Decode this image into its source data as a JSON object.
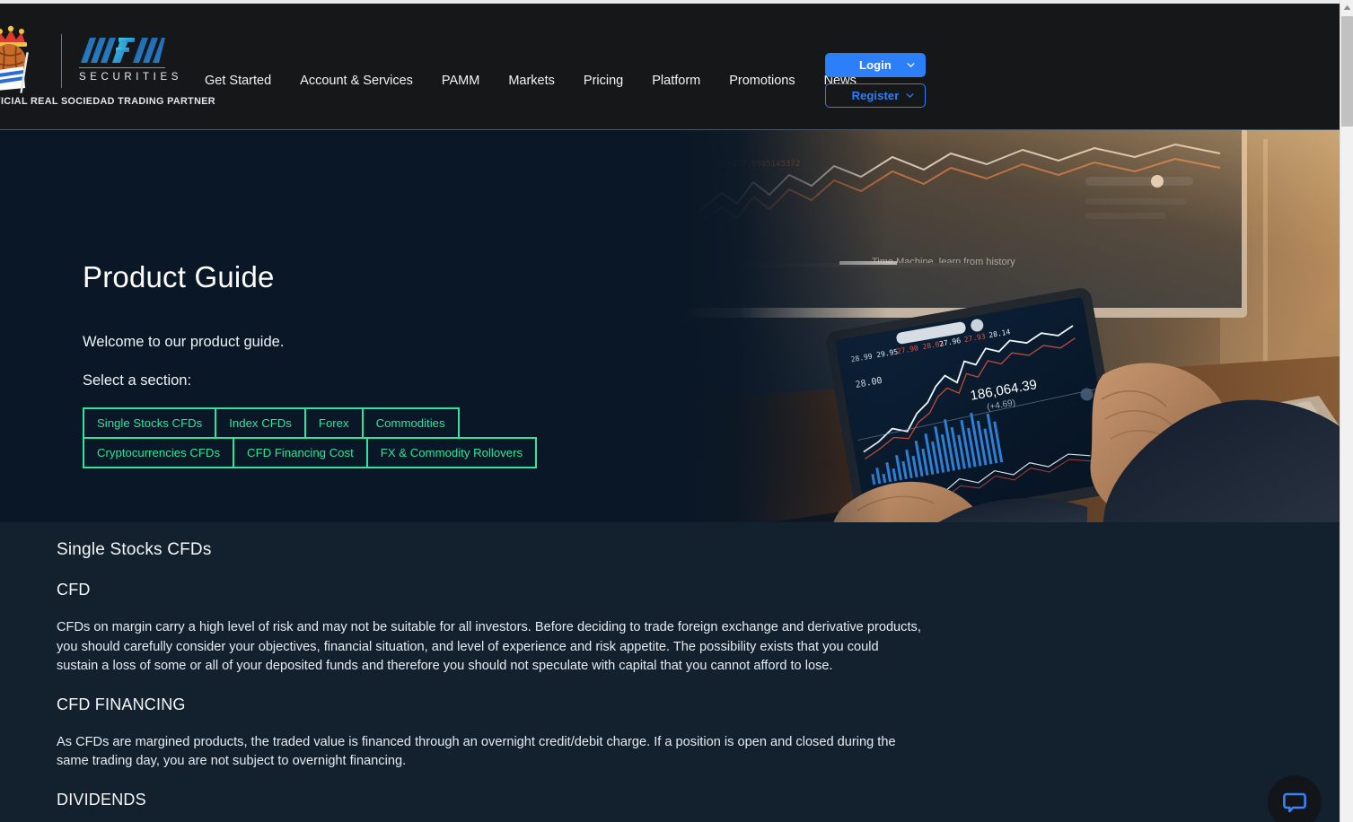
{
  "brand": {
    "crest_name": "real-sociedad-crest",
    "logo_word": "SECURITIES",
    "partner_tagline": "FICIAL REAL SOCIEDAD TRADING PARTNER",
    "accent_blue": "#2d7ff9",
    "accent_green": "#2ee59d",
    "nav_background": "#151719",
    "hero_background": "#0a1726",
    "content_background": "#13212f"
  },
  "nav": {
    "items": [
      {
        "label": "Get Started"
      },
      {
        "label": "Account & Services"
      },
      {
        "label": "PAMM"
      },
      {
        "label": "Markets"
      },
      {
        "label": "Pricing"
      },
      {
        "label": "Platform"
      },
      {
        "label": "Promotions"
      },
      {
        "label": "News"
      }
    ],
    "login_label": "Login",
    "register_label": "Register"
  },
  "hero": {
    "title": "Product Guide",
    "lead": "Welcome to our product guide.",
    "select_label": "Select a section:",
    "section_buttons": [
      {
        "label": "Single Stocks CFDs"
      },
      {
        "label": "Index CFDs"
      },
      {
        "label": "Forex"
      },
      {
        "label": "Commodities"
      },
      {
        "label": "Cryptocurrencies CFDs"
      },
      {
        "label": "CFD Financing Cost"
      },
      {
        "label": "FX & Commodity Rollovers"
      }
    ]
  },
  "content": {
    "section_title": "Single Stocks CFDs",
    "blocks": [
      {
        "heading": "CFD",
        "paragraph": "CFDs on margin carry a high level of risk and may not be suitable for all investors. Before deciding to trade foreign exchange and derivative products, you should carefully consider your objectives, financial situation, and level of experience and risk appetite. The possibility exists that you could sustain a loss of some or all of your deposited funds and therefore you should not speculate with capital that you cannot afford to lose."
      },
      {
        "heading": "CFD FINANCING",
        "paragraph": "As CFDs are margined products, the traded value is financed through an overnight credit/debit charge. If a position is open and closed during the same trading day, you are not subject to overnight financing."
      },
      {
        "heading": "DIVIDENDS",
        "paragraph": ""
      }
    ]
  },
  "chat": {
    "icon": "chat-bubble-icon"
  }
}
